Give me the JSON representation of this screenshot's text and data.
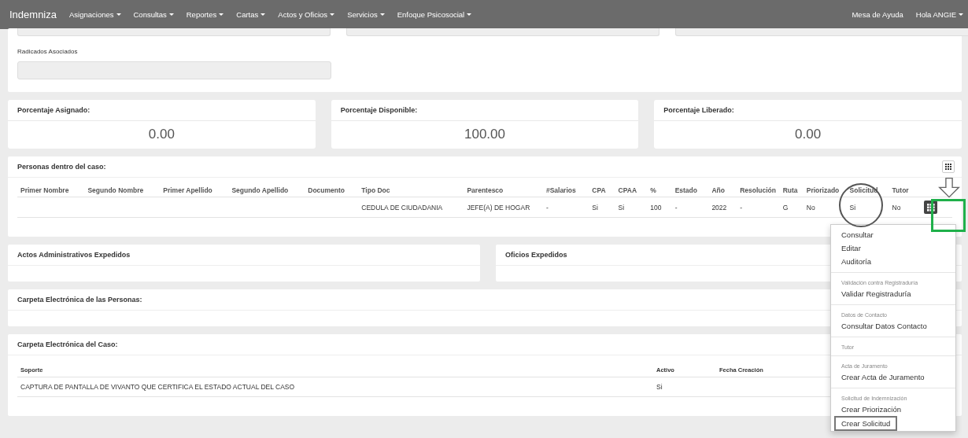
{
  "navbar": {
    "brand": "Indemniza",
    "menus": [
      {
        "label": "Asignaciones"
      },
      {
        "label": "Consultas"
      },
      {
        "label": "Reportes"
      },
      {
        "label": "Cartas"
      },
      {
        "label": "Actos y Oficios"
      },
      {
        "label": "Servicios"
      },
      {
        "label": "Enfoque Psicosocial"
      }
    ],
    "right": [
      {
        "label": "Mesa de Ayuda",
        "dropdown": false
      },
      {
        "label": "Hola ANGIE",
        "dropdown": true
      }
    ]
  },
  "case_panel": {
    "field_label": "Radicados Asociados"
  },
  "percent_cards": [
    {
      "label": "Porcentaje Asignado:",
      "value": "0.00"
    },
    {
      "label": "Porcentaje Disponible:",
      "value": "100.00"
    },
    {
      "label": "Porcentaje Liberado:",
      "value": "0.00"
    }
  ],
  "persons": {
    "title": "Personas dentro del caso:",
    "columns": [
      "Primer Nombre",
      "Segundo Nombre",
      "Primer Apellido",
      "Segundo Apellido",
      "Documento",
      "Tipo Doc",
      "Parentesco",
      "#Salarios",
      "CPA",
      "CPAA",
      "%",
      "Estado",
      "Año",
      "Resolución",
      "Ruta",
      "Priorizado",
      "Solicitud",
      "Tutor"
    ],
    "rows": [
      {
        "cells": [
          "",
          "",
          "",
          "",
          "",
          "CEDULA DE CIUDADANIA",
          "JEFE(A) DE HOGAR",
          "-",
          "Si",
          "Si",
          "100",
          "-",
          "2022",
          "-",
          "G",
          "No",
          "Si",
          "No"
        ]
      }
    ],
    "menu": [
      {
        "items": [
          {
            "label": "Consultar",
            "boxed": false
          },
          {
            "label": "Editar",
            "boxed": false
          },
          {
            "label": "Auditoría",
            "boxed": false
          }
        ]
      },
      {
        "header": "Validación contra Registraduría",
        "items": [
          {
            "label": "Validar Registraduría",
            "boxed": false
          }
        ]
      },
      {
        "header": "Datos de Contacto",
        "items": [
          {
            "label": "Consultar Datos Contacto",
            "boxed": false
          }
        ]
      },
      {
        "header": "Tutor"
      },
      {
        "header": "Acta de Juramento",
        "items": [
          {
            "label": "Crear Acta de Juramento",
            "boxed": false
          }
        ]
      },
      {
        "header": "Solicitud de Indemnización",
        "items": [
          {
            "label": "Crear Priorización",
            "boxed": false
          },
          {
            "label": "Crear Solicitud",
            "boxed": true
          }
        ]
      }
    ]
  },
  "panels": [
    {
      "title": "Actos Administrativos Expedidos"
    },
    {
      "title": "Oficios Expedidos"
    }
  ],
  "people_folder": {
    "title": "Carpeta Electrónica de las Personas:"
  },
  "case_folder": {
    "title": "Carpeta Electrónica del Caso:",
    "columns": [
      "Soporte",
      "Activo",
      "Fecha Creación"
    ],
    "rows": [
      {
        "cells": [
          "CAPTURA DE PANTALLA DE VIVANTO QUE CERTIFICA EL ESTADO ACTUAL DEL CASO",
          "Si",
          ""
        ]
      }
    ]
  }
}
